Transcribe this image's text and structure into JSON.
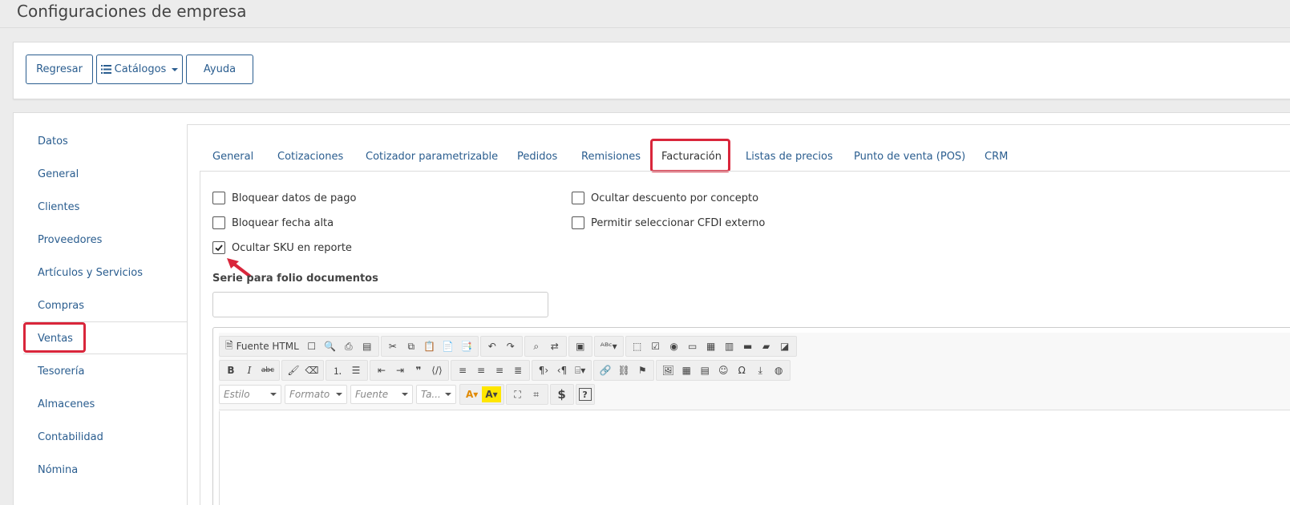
{
  "page": {
    "title": "Configuraciones de empresa"
  },
  "toolbar": {
    "regresar": "Regresar",
    "catalogos": "Catálogos",
    "ayuda": "Ayuda"
  },
  "sidebar": {
    "items": [
      {
        "label": "Datos"
      },
      {
        "label": "General"
      },
      {
        "label": "Clientes"
      },
      {
        "label": "Proveedores"
      },
      {
        "label": "Artículos y Servicios"
      },
      {
        "label": "Compras"
      },
      {
        "label": "Ventas"
      },
      {
        "label": "Tesorería"
      },
      {
        "label": "Almacenes"
      },
      {
        "label": "Contabilidad"
      },
      {
        "label": "Nómina"
      }
    ],
    "active": "Ventas"
  },
  "tabs": {
    "items": [
      {
        "label": "General"
      },
      {
        "label": "Cotizaciones"
      },
      {
        "label": "Cotizador parametrizable"
      },
      {
        "label": "Pedidos"
      },
      {
        "label": "Remisiones"
      },
      {
        "label": "Facturación"
      },
      {
        "label": "Listas de precios"
      },
      {
        "label": "Punto de venta (POS)"
      },
      {
        "label": "CRM"
      }
    ],
    "active": "Facturación"
  },
  "options": [
    {
      "label": "Bloquear datos de pago",
      "checked": false
    },
    {
      "label": "Bloquear fecha alta",
      "checked": false
    },
    {
      "label": "Ocultar SKU en reporte",
      "checked": true
    },
    {
      "label": "Ocultar descuento por concepto",
      "checked": false
    },
    {
      "label": "Permitir seleccionar CFDI externo",
      "checked": false
    }
  ],
  "serie": {
    "label": "Serie para folio documentos",
    "value": ""
  },
  "editor": {
    "source_label": "Fuente HTML",
    "combos": {
      "estilo": "Estilo",
      "formato": "Formato",
      "fuente": "Fuente",
      "tamano": "Ta..."
    }
  },
  "colors": {
    "accent": "#2a5d8f",
    "highlight": "#d9263b"
  }
}
